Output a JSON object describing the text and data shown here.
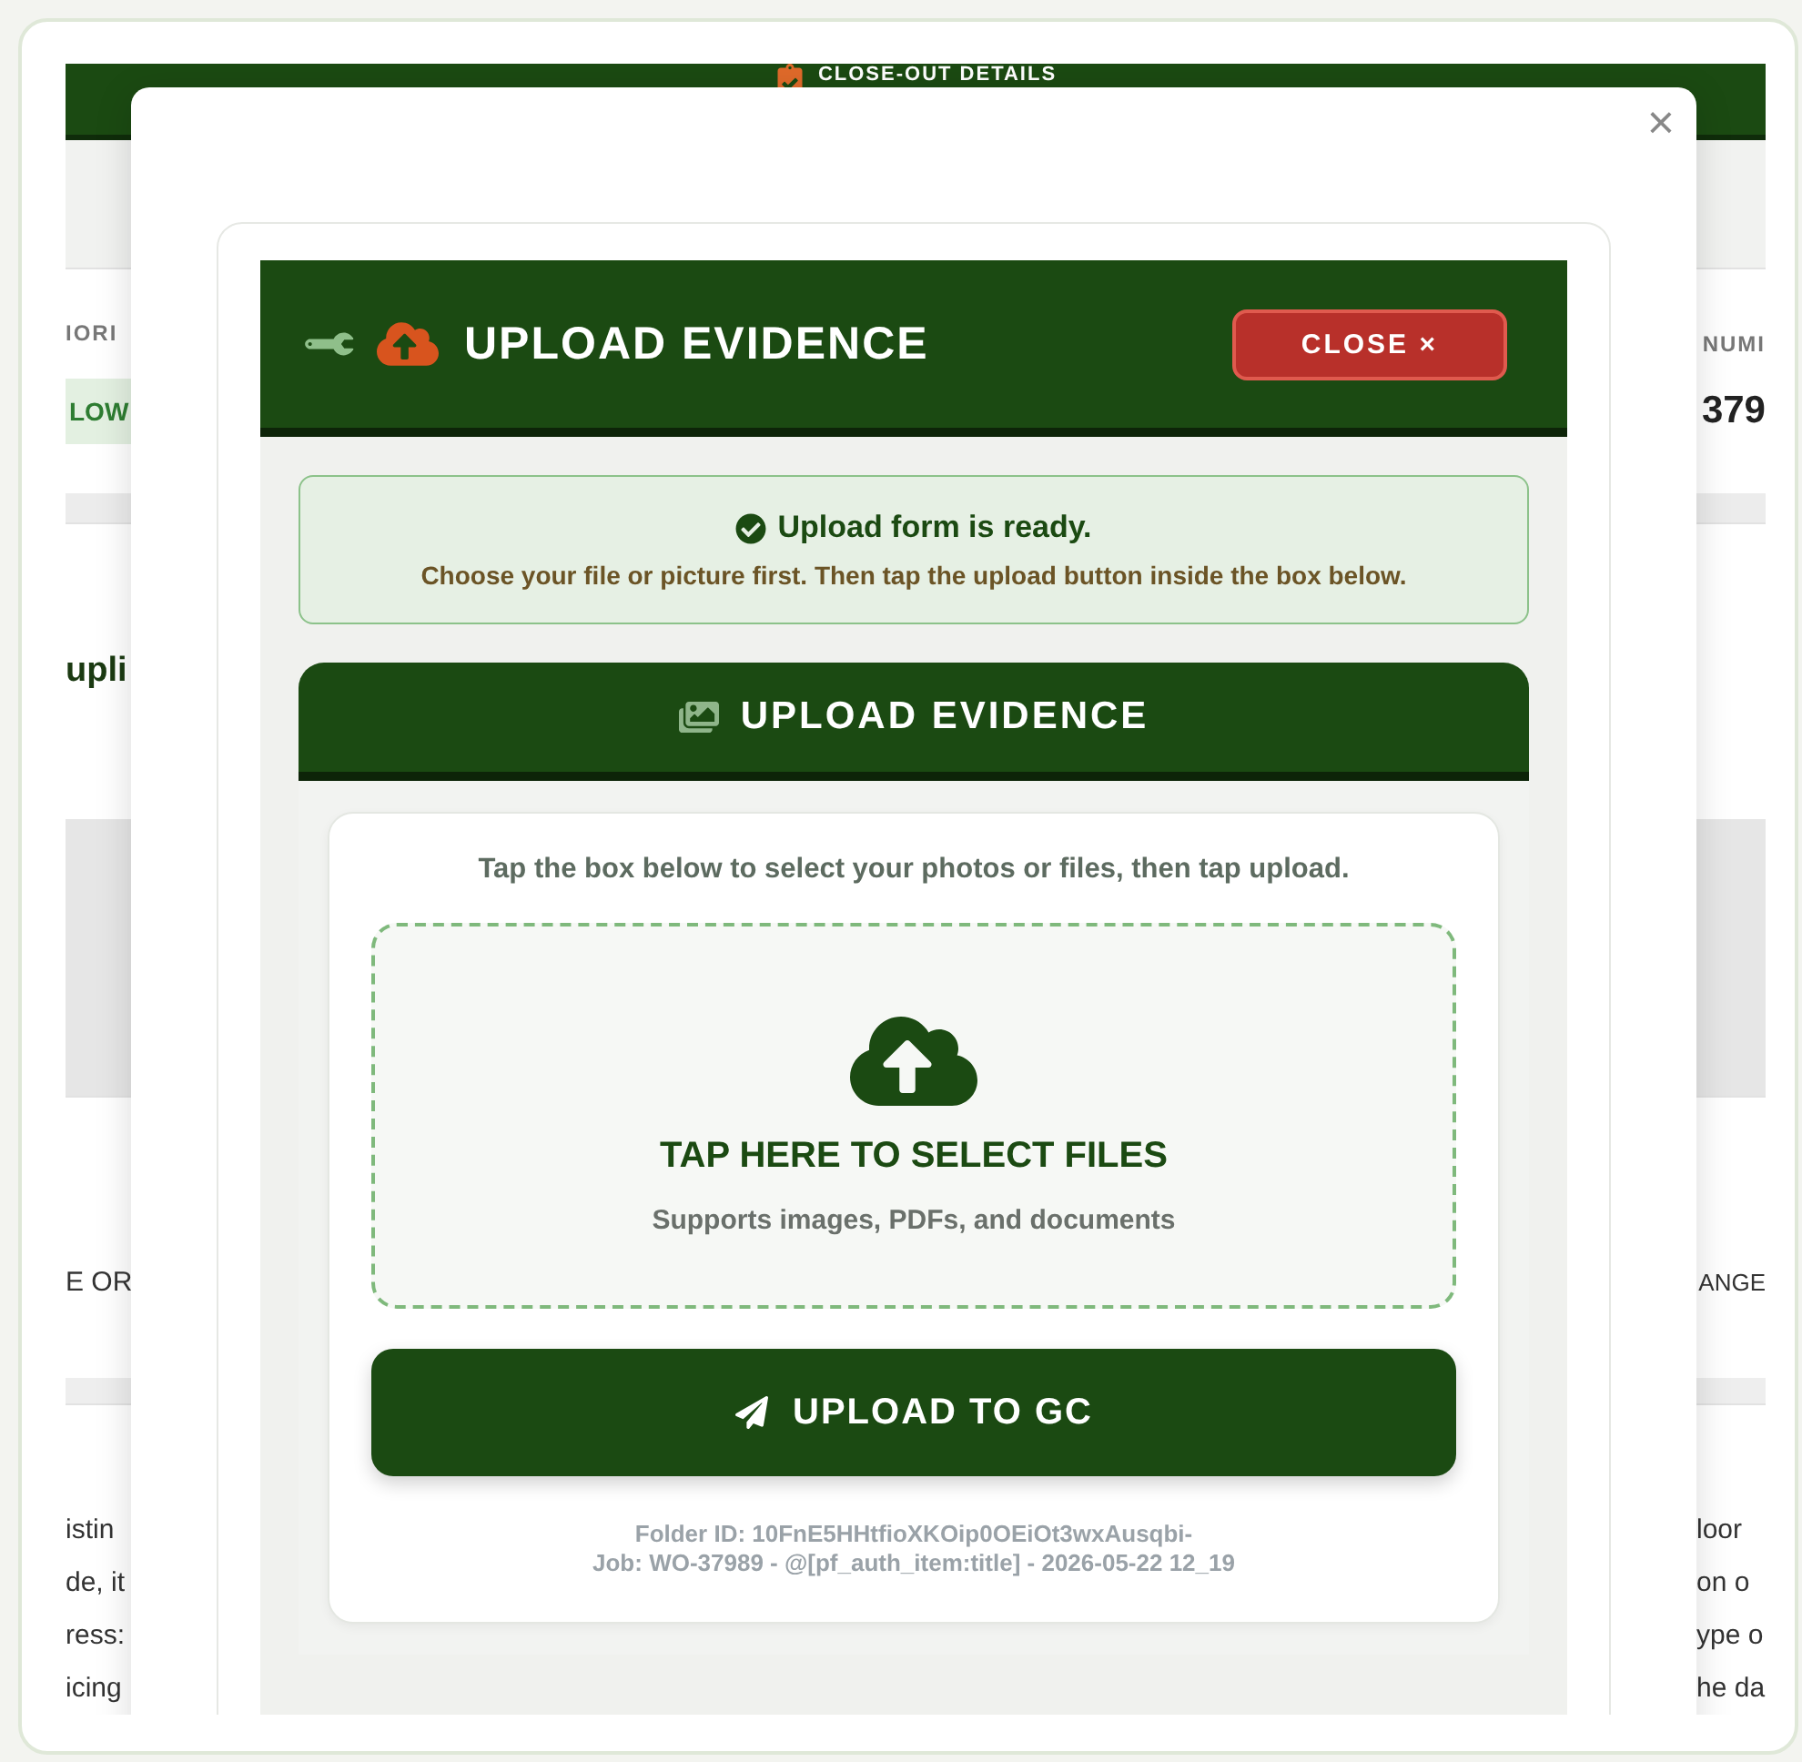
{
  "background_page": {
    "header_title": "CLOSE-OUT DETAILS",
    "info": {
      "left_label": "IORI",
      "left_value": "LOW",
      "right_label": "NUMI",
      "right_value": "379"
    },
    "section_heading": "upli",
    "field_row": {
      "left": "E OR",
      "right": "ANGE"
    },
    "paragraph_left": [
      "istin",
      "de, it",
      "ress:",
      "icing"
    ],
    "paragraph_right": [
      "loor",
      "on o",
      "ype o",
      "he da"
    ]
  },
  "modal": {
    "close_symbol": "×",
    "panel": {
      "title": "UPLOAD EVIDENCE",
      "close_button": "CLOSE ×",
      "notice": {
        "title": "Upload form is ready.",
        "message": "Choose your file or picture first. Then tap the upload button inside the box below."
      },
      "section": {
        "title": "UPLOAD EVIDENCE",
        "instructions": "Tap the box below to select your photos or files, then tap upload.",
        "dropzone": {
          "title": "TAP HERE TO SELECT FILES",
          "hint": "Supports images, PDFs, and documents"
        },
        "upload_button": "UPLOAD TO GC",
        "meta_lines": [
          "Folder ID: 10FnE5HHtfioXKOip0OEiOt3wxAusqbi-",
          "Job: WO-37989 - @[pf_auth_item:title] - 2026-05-22 12_19"
        ]
      }
    }
  }
}
